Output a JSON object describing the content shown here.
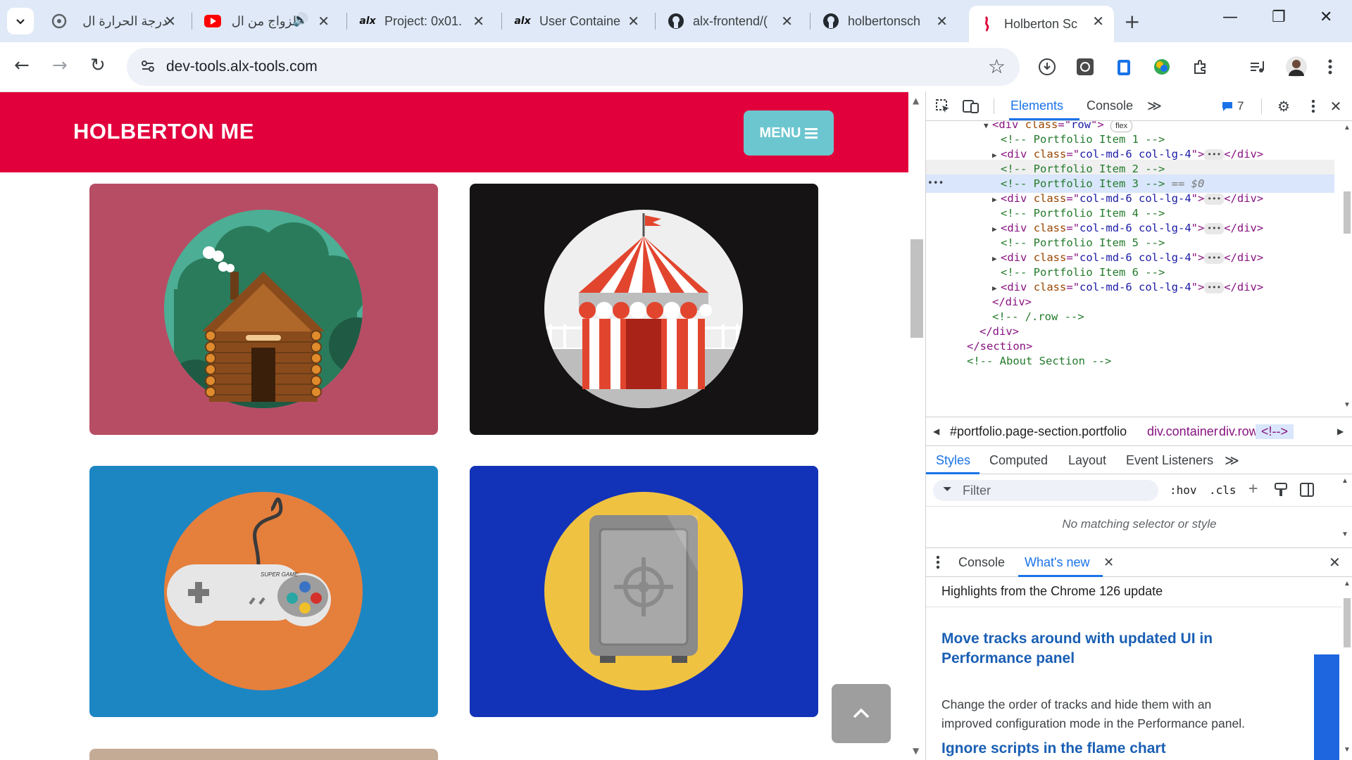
{
  "browser": {
    "tabs": [
      {
        "title": "درجة الحرارة ال",
        "favicon": "google-icon"
      },
      {
        "title": "الزواج من ال",
        "favicon": "youtube-icon"
      },
      {
        "title": "Project: 0x01.",
        "favicon": "alx-icon"
      },
      {
        "title": "User Containe",
        "favicon": "alx-icon"
      },
      {
        "title": "alx-frontend/(",
        "favicon": "github-icon"
      },
      {
        "title": "holbertonsch",
        "favicon": "github-icon"
      },
      {
        "title": "Holberton Sc",
        "favicon": "holberton-icon"
      }
    ],
    "url": "dev-tools.alx-tools.com"
  },
  "site": {
    "brand": "HOLBERTON ME",
    "menu_label": "MENU",
    "colors": {
      "nav": "#e1003c",
      "menu_button": "#6cc6cf"
    },
    "portfolio": [
      {
        "name": "cabin",
        "background": "#b74d64"
      },
      {
        "name": "circus",
        "background": "#151313"
      },
      {
        "name": "game",
        "background": "#1c86c3"
      },
      {
        "name": "safe",
        "background": "#1233b8"
      }
    ],
    "controller_text": "SUPER GAME"
  },
  "devtools": {
    "tabs": [
      "Elements",
      "Console"
    ],
    "issues_count": "7",
    "dom_lines": [
      {
        "text": "<div class=\"row\">"
      },
      {
        "comment": "<!-- Portfolio Item 1 -->"
      },
      {
        "comment": "<!-- Portfolio Item 2 -->"
      },
      {
        "comment": "<!-- Portfolio Item 3 -->",
        "selected_suffix": "== $0"
      },
      {
        "comment": "<!-- Portfolio Item 4 -->"
      },
      {
        "comment": "<!-- Portfolio Item 5 -->"
      },
      {
        "comment": "<!-- Portfolio Item 6 -->"
      },
      {
        "comment": "<!-- /.row -->"
      },
      {
        "comment": "<!-- About Section -->"
      }
    ],
    "col_div": {
      "tag": "div",
      "attr": "class",
      "value": "col-md-6 col-lg-4"
    },
    "flex_badge": "flex",
    "breadcrumbs": [
      "#portfolio.page-section.portfolio",
      "div.container",
      "div.row",
      "<!-->"
    ],
    "styles_tabs": [
      "Styles",
      "Computed",
      "Layout",
      "Event Listeners"
    ],
    "filter_placeholder": "Filter",
    "hov": ":hov",
    "cls": ".cls",
    "no_match": "No matching selector or style",
    "drawer_tabs": [
      "Console",
      "What's new"
    ],
    "whats_new": {
      "subtitle": "Highlights from the Chrome 126 update",
      "headline1": "Move tracks around with updated UI in Performance panel",
      "body1": "Change the order of tracks and hide them with an improved configuration mode in the Performance panel.",
      "headline2": "Ignore scripts in the flame chart"
    }
  }
}
